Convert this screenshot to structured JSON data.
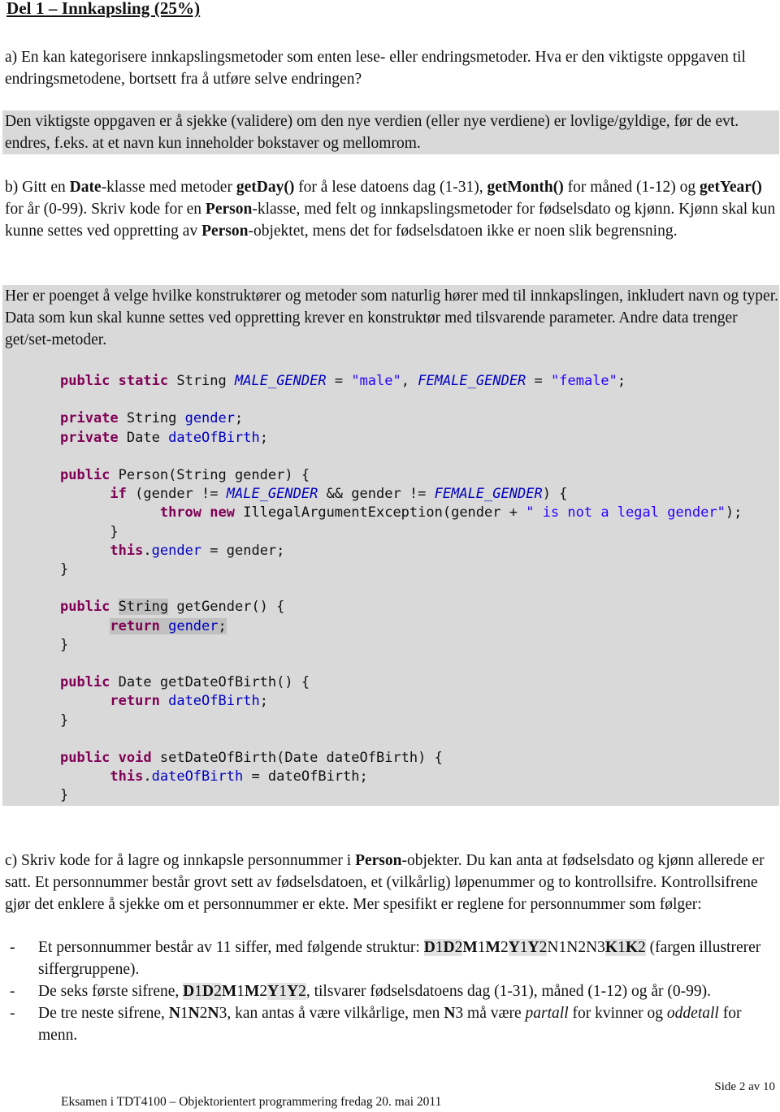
{
  "heading": "Del 1 – Innkapsling (25%)",
  "part_a": {
    "question": "a) En kan kategorisere innkapslingsmetoder som enten lese- eller endringsmetoder. Hva er den viktigste oppgaven til endringsmetodene, bortsett fra å utføre selve endringen?",
    "answer": "Den viktigste oppgaven er å sjekke (validere) om den nye verdien (eller nye verdiene) er lovlige/gyldige, før de evt. endres, f.eks. at et navn kun inneholder bokstaver og mellomrom."
  },
  "part_b": {
    "q1": "b) Gitt en ",
    "date_cls": "Date",
    "q2": "-klasse med metoder ",
    "getday": "getDay()",
    "q3": " for å lese datoens dag (1-31), ",
    "getmonth": "getMonth()",
    "q4": " for måned (1-12) og ",
    "getyear": "getYear()",
    "q5": " for år (0-99). Skriv kode for en ",
    "person1": "Person",
    "q6": "-klasse, med felt og innkapslingsmetoder for fødselsdato og kjønn. Kjønn skal kun kunne settes ved oppretting av ",
    "person2": "Person",
    "q7": "-objektet, mens det for fødselsdatoen ikke er noen slik begrensning.",
    "answer": "Her er poenget å velge hvilke konstruktører og metoder som naturlig hører med til innkapslingen, inkludert navn og typer. Data som kun skal kunne settes ved oppretting krever en konstruktør med tilsvarende parameter. Andre data trenger get/set-metoder."
  },
  "code": {
    "kw_public": "public",
    "kw_static": "static",
    "kw_private": "private",
    "kw_if": "if",
    "kw_throw": "throw",
    "kw_new": "new",
    "kw_this": "this",
    "kw_return": "return",
    "kw_void": "void",
    "t_string": "String",
    "t_date": "Date",
    "c_male": "MALE_GENDER",
    "c_female": "FEMALE_GENDER",
    "s_male": "\"male\"",
    "s_female": "\"female\"",
    "s_msg": "\" is not a legal gender\"",
    "f_gender": "gender",
    "f_dob": "dateOfBirth",
    "l1_eq": " = ",
    "l1_comma": ", ",
    "semi": ";",
    "ctor": " Person(String gender) {",
    "if_open": " (gender != ",
    "if_and": " && gender != ",
    "if_close": ") {",
    "exc_open": " IllegalArgumentException(gender + ",
    "exc_close": ");",
    "brace_close": "}",
    "assign_gender": " = gender;",
    "get_gender": " getGender() {",
    "get_dob": " getDateOfBirth() {",
    "set_dob": " setDateOfBirth(Date dateOfBirth) {",
    "assign_dob": " = dateOfBirth;"
  },
  "part_c": {
    "c1": "c) Skriv kode for å lagre og innkapsle personnummer i ",
    "person": "Person",
    "c2": "-objekter. Du kan anta at fødselsdato og kjønn allerede er satt. Et personnummer består grovt sett av fødselsdatoen, et (vilkårlig) løpenummer og to kontrollsifre. Kontrollsifrene gjør det enklere å sjekke om et personnummer er ekte. Mer spesifikt er reglene for personnummer som følger:",
    "bullets": [
      {
        "dash": "-",
        "pre": "Et personnummer består av 11 siffer, med følgende struktur: ",
        "post": "(fargen illustrerer siffergruppene)."
      },
      {
        "dash": "-",
        "pre": "De seks første sifrene, ",
        "post": ", tilsvarer fødselsdatoens dag (1-31), måned (1-12) og år (0-99)."
      },
      {
        "dash": "-",
        "pre": "De tre neste sifrene, ",
        "n3": "N",
        "n3d": "3",
        "mid": ", kan antas å være vilkårlige, men ",
        "mid2": " må være ",
        "partall": "partall",
        "mid3": " for kvinner og ",
        "oddetall": "oddetall",
        "post": " for menn."
      }
    ],
    "digits": {
      "D": "D",
      "M": "M",
      "Y": "Y",
      "N": "N",
      "K": "K",
      "d1": "1",
      "d2": "2",
      "d3": "3"
    }
  },
  "footer": {
    "page": "Side 2 av 10",
    "exam": "Eksamen i TDT4100 – Objektorientert programmering fredag 20. mai 2011"
  }
}
